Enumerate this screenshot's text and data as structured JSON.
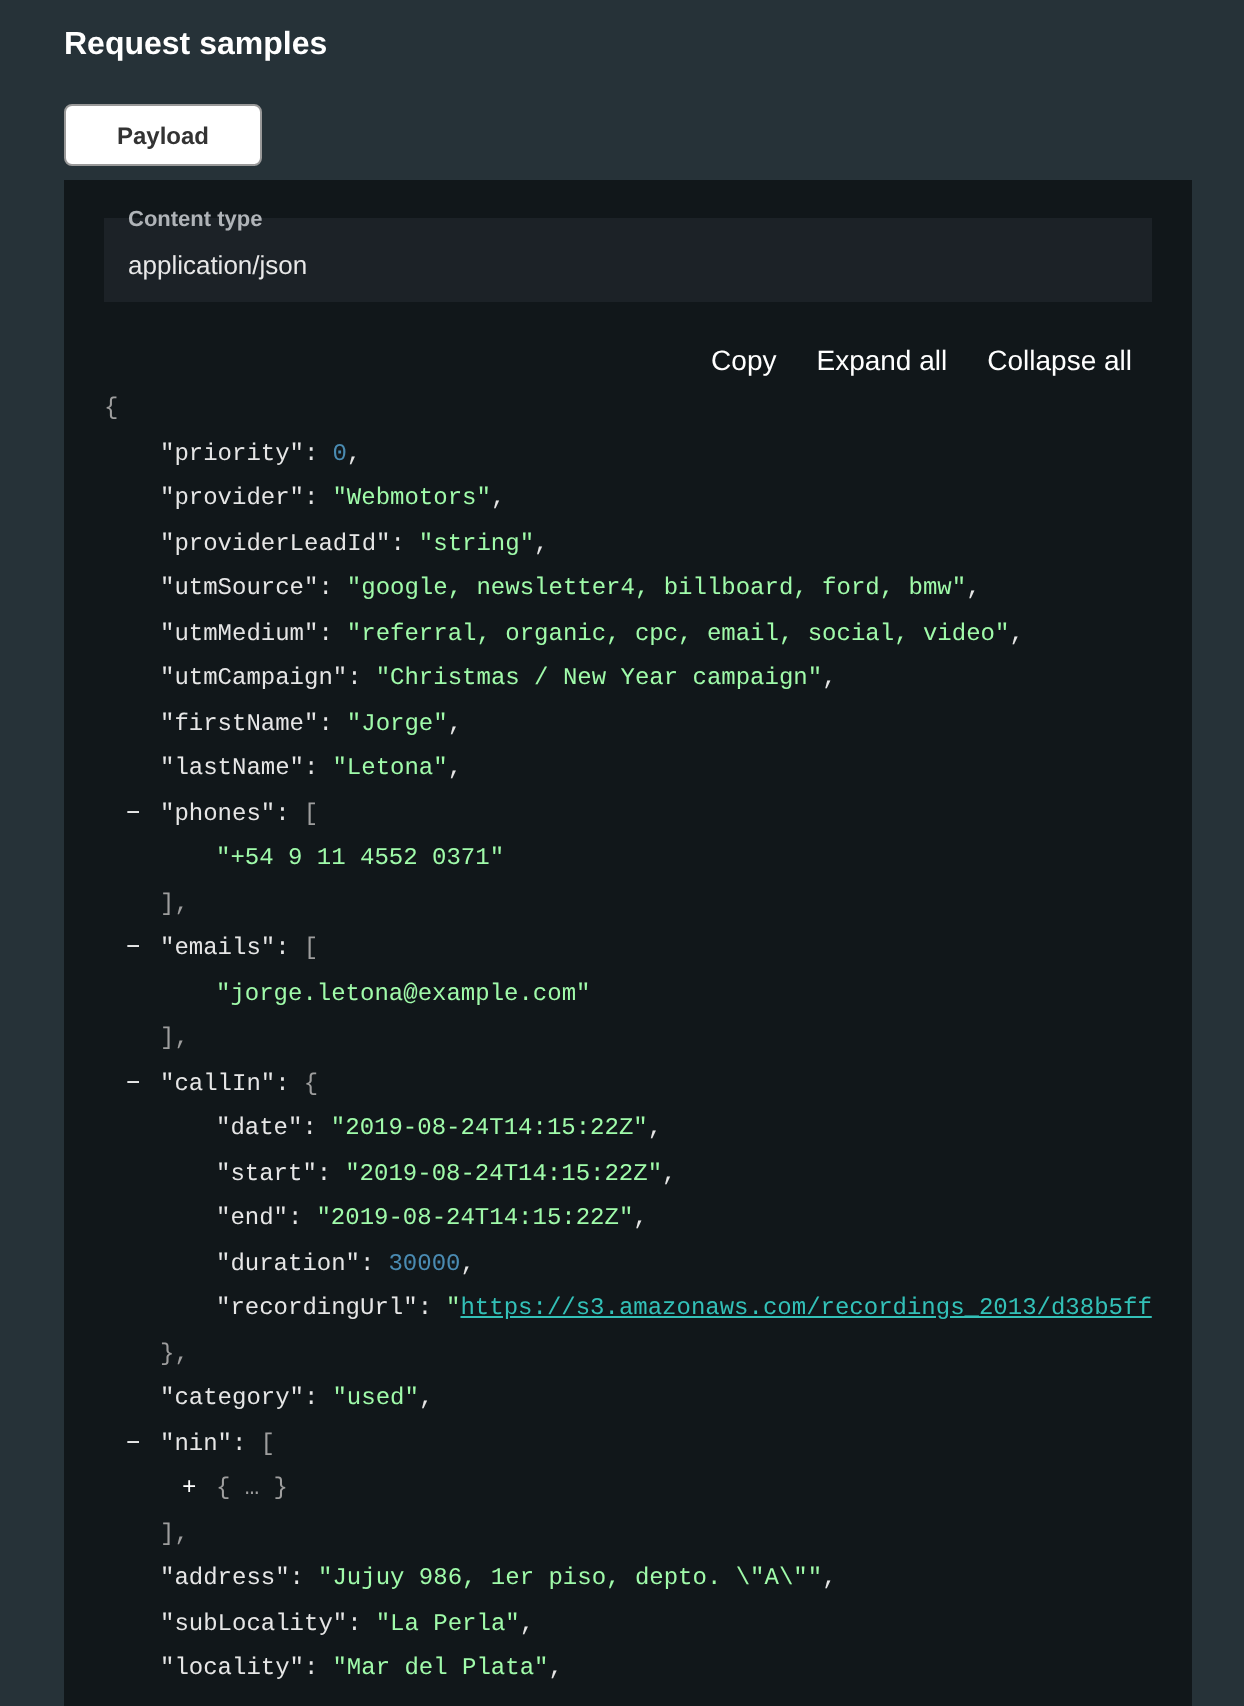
{
  "heading": "Request samples",
  "tabs": [
    {
      "label": "Payload",
      "selected": true
    }
  ],
  "content_type": {
    "label": "Content type",
    "value": "application/json"
  },
  "actions": [
    "Copy",
    "Expand all",
    "Collapse all"
  ],
  "json": {
    "open": "{",
    "children": [
      {
        "kind": "number",
        "key": "\"priority\":",
        "value": "0",
        "comma": ","
      },
      {
        "kind": "string",
        "key": "\"provider\":",
        "value": "\"Webmotors\"",
        "comma": ","
      },
      {
        "kind": "string",
        "key": "\"providerLeadId\":",
        "value": "\"string\"",
        "comma": ","
      },
      {
        "kind": "string",
        "key": "\"utmSource\":",
        "value": "\"google, newsletter4, billboard, ford, bmw\"",
        "comma": ","
      },
      {
        "kind": "string",
        "key": "\"utmMedium\":",
        "value": "\"referral, organic, cpc, email, social, video\"",
        "comma": ","
      },
      {
        "kind": "string",
        "key": "\"utmCampaign\":",
        "value": "\"Christmas / New Year campaign\"",
        "comma": ","
      },
      {
        "kind": "string",
        "key": "\"firstName\":",
        "value": "\"Jorge\"",
        "comma": ","
      },
      {
        "kind": "string",
        "key": "\"lastName\":",
        "value": "\"Letona\"",
        "comma": ","
      },
      {
        "kind": "container",
        "toggle": "−",
        "key": "\"phones\":",
        "open": "[",
        "close": "],",
        "children": [
          {
            "kind": "string",
            "value": "\"+54 9 11 4552 0371\""
          }
        ]
      },
      {
        "kind": "container",
        "toggle": "−",
        "key": "\"emails\":",
        "open": "[",
        "close": "],",
        "children": [
          {
            "kind": "string",
            "value": "\"jorge.letona@example.com\""
          }
        ]
      },
      {
        "kind": "container",
        "toggle": "−",
        "key": "\"callIn\":",
        "open": "{",
        "close": "},",
        "children": [
          {
            "kind": "string",
            "key": "\"date\":",
            "value": "\"2019-08-24T14:15:22Z\"",
            "comma": ","
          },
          {
            "kind": "string",
            "key": "\"start\":",
            "value": "\"2019-08-24T14:15:22Z\"",
            "comma": ","
          },
          {
            "kind": "string",
            "key": "\"end\":",
            "value": "\"2019-08-24T14:15:22Z\"",
            "comma": ","
          },
          {
            "kind": "number",
            "key": "\"duration\":",
            "value": "30000",
            "comma": ","
          },
          {
            "kind": "link",
            "key": "\"recordingUrl\":",
            "quote": "\"",
            "value": "https://s3.amazonaws.com/recordings_2013/d38b5ff"
          }
        ]
      },
      {
        "kind": "string",
        "key": "\"category\":",
        "value": "\"used\"",
        "comma": ","
      },
      {
        "kind": "container",
        "toggle": "−",
        "key": "\"nin\":",
        "open": "[",
        "close": "],",
        "children": [
          {
            "kind": "collapsed",
            "toggle": "+",
            "text": "{ … }"
          }
        ]
      },
      {
        "kind": "string",
        "key": "\"address\":",
        "value": "\"Jujuy 986, 1er piso, depto. \\\"A\\\"\"",
        "comma": ","
      },
      {
        "kind": "string",
        "key": "\"subLocality\":",
        "value": "\"La Perla\"",
        "comma": ","
      },
      {
        "kind": "string",
        "key": "\"locality\":",
        "value": "\"Mar del Plata\"",
        "comma": ","
      }
    ]
  }
}
